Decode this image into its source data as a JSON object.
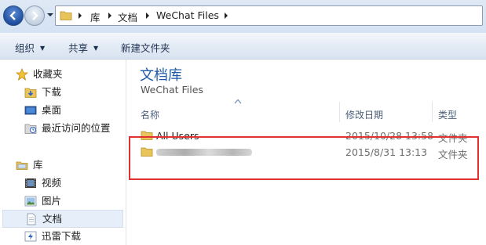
{
  "address": {
    "crumbs": [
      "库",
      "文档",
      "WeChat Files"
    ]
  },
  "toolbar": {
    "organize": "组织",
    "share": "共享",
    "new_folder": "新建文件夹"
  },
  "nav": {
    "favorites": "收藏夹",
    "downloads": "下载",
    "desktop": "桌面",
    "recent": "最近访问的位置",
    "libraries": "库",
    "videos": "视频",
    "pictures": "图片",
    "documents": "文档",
    "thunder": "迅雷下载"
  },
  "library": {
    "title": "文档库",
    "subtitle": "WeChat Files"
  },
  "columns": {
    "name": "名称",
    "modified": "修改日期",
    "type": "类型"
  },
  "files": [
    {
      "name": "All Users",
      "modified": "2015/10/28 13:58",
      "type": "文件夹"
    },
    {
      "name": "",
      "modified": "2015/8/31 13:13",
      "type": "文件夹"
    }
  ],
  "colors": {
    "accent": "#1e5aa8",
    "highlight_box": "#e03030",
    "selected_nav": "#e5eef9"
  }
}
